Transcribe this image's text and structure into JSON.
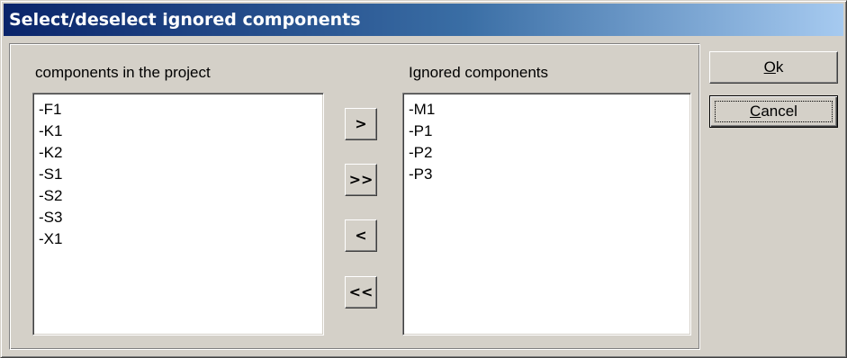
{
  "dialog": {
    "title": "Select/deselect ignored components"
  },
  "left_list": {
    "label": "components in the project",
    "items": [
      "-F1",
      "-K1",
      "-K2",
      "-S1",
      "-S2",
      "-S3",
      "-X1"
    ]
  },
  "right_list": {
    "label": "Ignored components",
    "items": [
      "-M1",
      "-P1",
      "-P2",
      "-P3"
    ]
  },
  "transfer_buttons": {
    "move_selected_right": ">",
    "move_all_right": ">>",
    "move_selected_left": "<",
    "move_all_left": "<<"
  },
  "buttons": {
    "ok": {
      "mnemonic": "O",
      "rest": "k"
    },
    "cancel": {
      "mnemonic": "C",
      "rest": "ancel"
    }
  },
  "colors": {
    "face": "#d4d0c8",
    "title_start": "#0a246a",
    "title_end": "#a6caf0"
  }
}
